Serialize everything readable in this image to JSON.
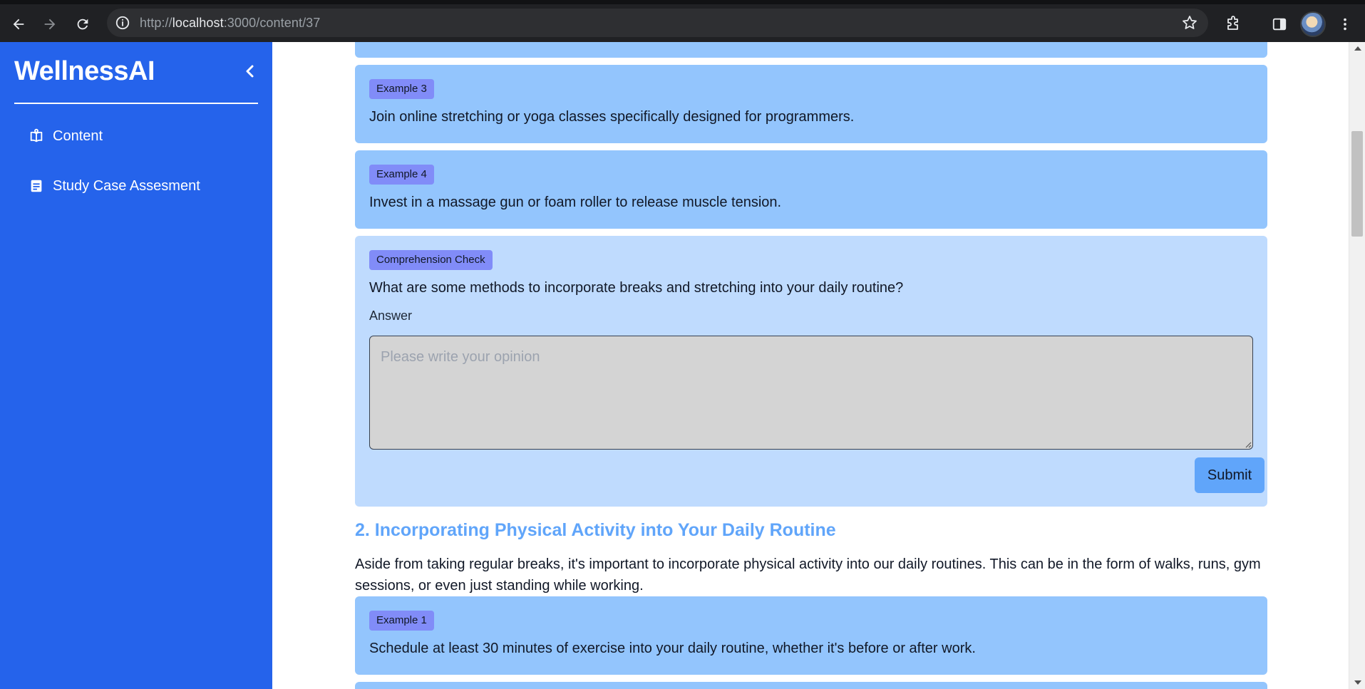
{
  "browser": {
    "url_scheme": "http://",
    "url_host": "localhost",
    "url_path": ":3000/content/37"
  },
  "sidebar": {
    "brand": "WellnessAI",
    "items": [
      {
        "label": "Content",
        "icon": "book-open-icon"
      },
      {
        "label": "Study Case Assesment",
        "icon": "document-icon"
      }
    ]
  },
  "main": {
    "examples_top": [
      {
        "badge": "Example 3",
        "text": "Join online stretching or yoga classes specifically designed for programmers."
      },
      {
        "badge": "Example 4",
        "text": "Invest in a massage gun or foam roller to release muscle tension."
      }
    ],
    "comprehension": {
      "badge": "Comprehension Check",
      "question": "What are some methods to incorporate breaks and stretching into your daily routine?",
      "answer_label": "Answer",
      "answer_placeholder": "Please write your opinion",
      "submit_label": "Submit"
    },
    "section": {
      "heading": "2. Incorporating Physical Activity into Your Daily Routine",
      "paragraph": "Aside from taking regular breaks, it's important to incorporate physical activity into our daily routines. This can be in the form of walks, runs, gym sessions, or even just standing while working."
    },
    "examples_bottom": [
      {
        "badge": "Example 1",
        "text": "Schedule at least 30 minutes of exercise into your daily routine, whether it's before or after work."
      }
    ]
  },
  "colors": {
    "sidebar": "#2563eb",
    "example_card": "#93c5fd",
    "check_card": "#bfdbfe",
    "badge": "#818cf8",
    "heading": "#60a5fa",
    "submit": "#60a5fa"
  }
}
